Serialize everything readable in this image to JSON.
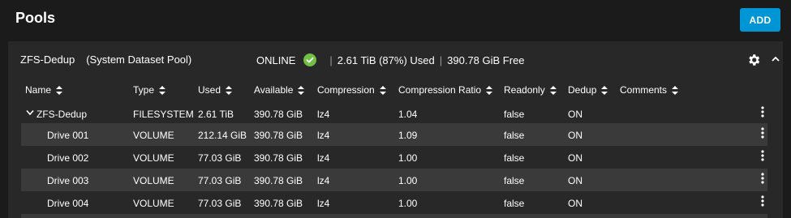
{
  "header": {
    "title": "Pools",
    "add_label": "ADD"
  },
  "pool": {
    "name": "ZFS-Dedup",
    "note": "(System Dataset Pool)",
    "status": "ONLINE",
    "used": "2.61 TiB (87%) Used",
    "free": "390.78 GiB Free",
    "status_color": "#71bf44"
  },
  "columns": [
    "Name",
    "Type",
    "Used",
    "Available",
    "Compression",
    "Compression Ratio",
    "Readonly",
    "Dedup",
    "Comments"
  ],
  "rows": [
    {
      "name": "ZFS-Dedup",
      "type": "FILESYSTEM",
      "used": "2.61 TiB",
      "available": "390.78 GiB",
      "compression": "lz4",
      "ratio": "1.04",
      "readonly": "false",
      "dedup": "ON",
      "comments": ""
    },
    {
      "name": "Drive 001",
      "type": "VOLUME",
      "used": "212.14 GiB",
      "available": "390.78 GiB",
      "compression": "lz4",
      "ratio": "1.09",
      "readonly": "false",
      "dedup": "ON",
      "comments": ""
    },
    {
      "name": "Drive 002",
      "type": "VOLUME",
      "used": "77.03 GiB",
      "available": "390.78 GiB",
      "compression": "lz4",
      "ratio": "1.00",
      "readonly": "false",
      "dedup": "ON",
      "comments": ""
    },
    {
      "name": "Drive 003",
      "type": "VOLUME",
      "used": "77.03 GiB",
      "available": "390.78 GiB",
      "compression": "lz4",
      "ratio": "1.00",
      "readonly": "false",
      "dedup": "ON",
      "comments": ""
    },
    {
      "name": "Drive 004",
      "type": "VOLUME",
      "used": "77.03 GiB",
      "available": "390.78 GiB",
      "compression": "lz4",
      "ratio": "1.00",
      "readonly": "false",
      "dedup": "ON",
      "comments": ""
    }
  ],
  "colors": {
    "accent": "#0095d5",
    "status_ok": "#71bf44"
  }
}
